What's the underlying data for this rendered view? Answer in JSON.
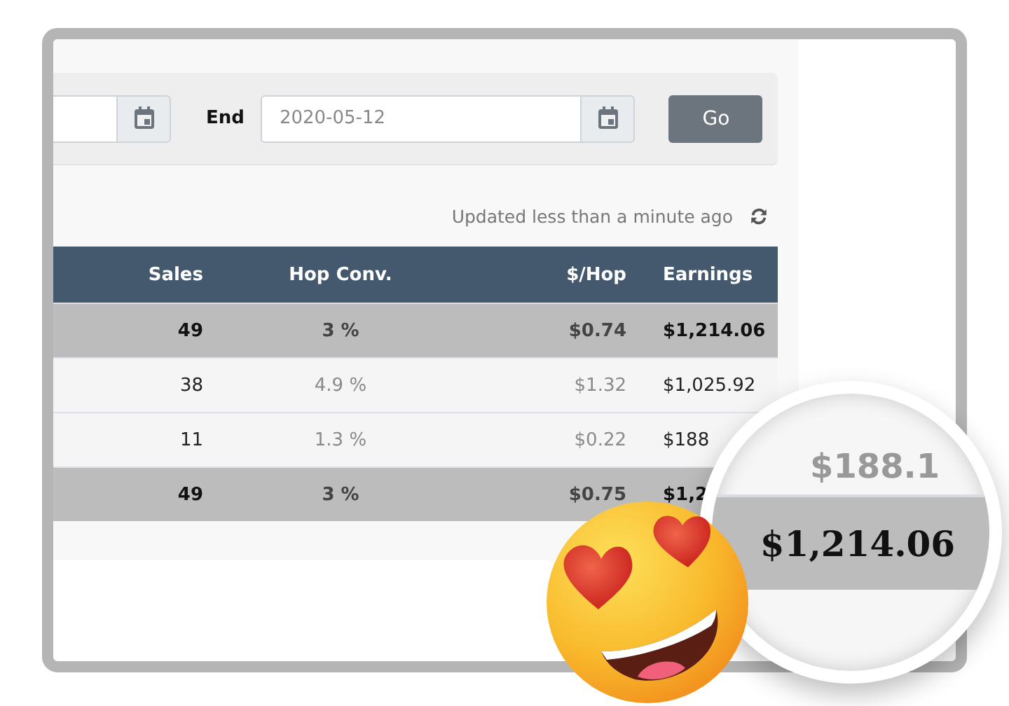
{
  "filter_bar": {
    "end_label": "End",
    "end_value": "2020-05-12",
    "go_button": "Go"
  },
  "updated_text": "Updated less than a minute ago",
  "table": {
    "columns": [
      "Sales",
      "Hop Conv.",
      "$/Hop",
      "Earnings"
    ],
    "rows": [
      {
        "kind": "total",
        "cells": [
          "49",
          "3 %",
          "$0.74",
          "$1,214.06"
        ]
      },
      {
        "kind": "normal",
        "cells": [
          "38",
          "4.9 %",
          "$1.32",
          "$1,025.92"
        ]
      },
      {
        "kind": "normal",
        "cells": [
          "11",
          "1.3 %",
          "$0.22",
          "$188"
        ]
      },
      {
        "kind": "total",
        "cells": [
          "49",
          "3 %",
          "$0.75",
          "$1,2"
        ]
      }
    ]
  },
  "magnifier": {
    "top_text": "$188.1",
    "main_text": "$1,214.06"
  }
}
